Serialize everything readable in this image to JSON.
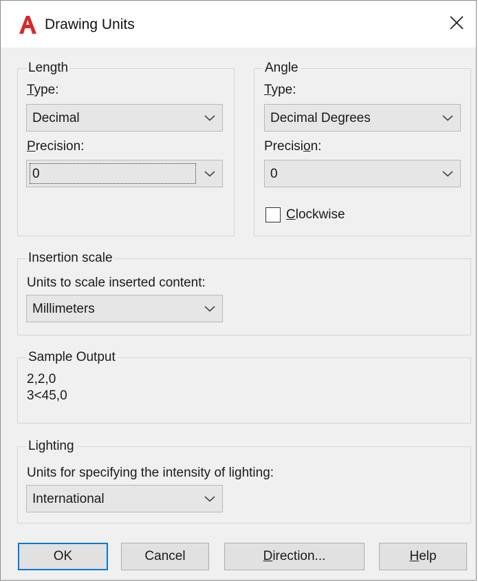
{
  "window": {
    "title": "Drawing Units",
    "close_symbol": "✕"
  },
  "length": {
    "legend": "Length",
    "type_label": "Type:",
    "type_value": "Decimal",
    "precision_label": "Precision:",
    "precision_value": "0"
  },
  "angle": {
    "legend": "Angle",
    "type_label": "Type:",
    "type_value": "Decimal Degrees",
    "precision_label": "Precision:",
    "precision_value": "0",
    "clockwise_label": "Clockwise",
    "clockwise_checked": false
  },
  "insertion": {
    "legend": "Insertion scale",
    "units_label": "Units to scale inserted content:",
    "units_value": "Millimeters"
  },
  "sample": {
    "legend": "Sample Output",
    "line1": "2,2,0",
    "line2": "3<45,0"
  },
  "lighting": {
    "legend": "Lighting",
    "units_label": "Units for specifying the intensity of lighting:",
    "units_value": "International"
  },
  "buttons": {
    "ok": "OK",
    "cancel": "Cancel",
    "direction": "Direction...",
    "help": "Help"
  },
  "colors": {
    "app_icon": "#d42a2a",
    "dialog_bg": "#f0f0f0",
    "default_button_border": "#0078d7"
  },
  "icons": {
    "app": "autocad-a-icon",
    "close": "close-icon",
    "dropdown": "chevron-down-icon"
  }
}
